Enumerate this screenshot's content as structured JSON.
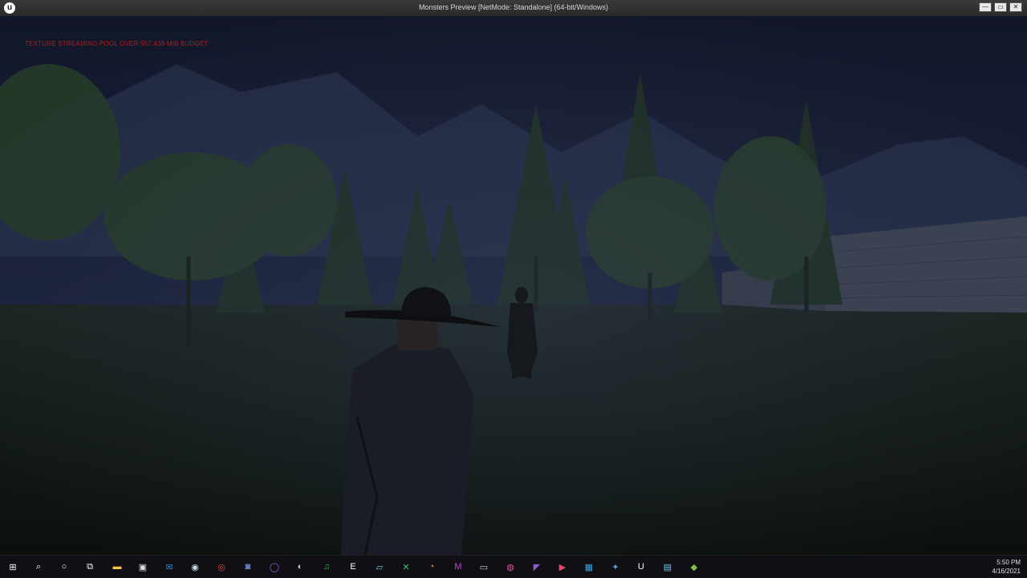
{
  "window": {
    "title": "Monsters Preview [NetMode: Standalone]  (64-bit/Windows)",
    "logo_letter": "u",
    "controls": [
      "—",
      "▭",
      "✕"
    ]
  },
  "viewport": {
    "warning": "TEXTURE STREAMING POOL OVER 557.438 MiB BUDGET",
    "warning_color": "#b01c1c"
  },
  "taskbar": {
    "icons": [
      {
        "name": "start-icon",
        "glyph": "⊞",
        "color": "#ffffff"
      },
      {
        "name": "search-icon",
        "glyph": "⌕",
        "color": "#ffffff"
      },
      {
        "name": "cortana-icon",
        "glyph": "○",
        "color": "#ffffff"
      },
      {
        "name": "task-view-icon",
        "glyph": "⧉",
        "color": "#ffffff"
      },
      {
        "name": "file-explorer-icon",
        "glyph": "▬",
        "color": "#f2c14e"
      },
      {
        "name": "store-icon",
        "glyph": "▣",
        "color": "#dddddd"
      },
      {
        "name": "mail-icon",
        "glyph": "✉",
        "color": "#2b88d8"
      },
      {
        "name": "steam-icon",
        "glyph": "◉",
        "color": "#cfd8e3"
      },
      {
        "name": "chrome-icon",
        "glyph": "◎",
        "color": "#e34133"
      },
      {
        "name": "discord-icon",
        "glyph": "◙",
        "color": "#7289da"
      },
      {
        "name": "app-circle-icon",
        "glyph": "◯",
        "color": "#9b59d0"
      },
      {
        "name": "obs-icon",
        "glyph": "◐",
        "color": "#cccccc"
      },
      {
        "name": "spotify-icon",
        "glyph": "♫",
        "color": "#1db954"
      },
      {
        "name": "epic-games-icon",
        "glyph": "E",
        "color": "#ffffff"
      },
      {
        "name": "notes-icon",
        "glyph": "▱",
        "color": "#7fd3e0"
      },
      {
        "name": "xbox-icon",
        "glyph": "✕",
        "color": "#33c36b"
      },
      {
        "name": "blender-icon",
        "glyph": "◔",
        "color": "#f0922b"
      },
      {
        "name": "app-m-icon",
        "glyph": "M",
        "color": "#b24bcf"
      },
      {
        "name": "terminal-icon",
        "glyph": "▭",
        "color": "#cccccc"
      },
      {
        "name": "photos-icon",
        "glyph": "◍",
        "color": "#e64aa0"
      },
      {
        "name": "visual-studio-icon",
        "glyph": "◤",
        "color": "#8e5bd6"
      },
      {
        "name": "media-icon",
        "glyph": "▶",
        "color": "#e64a6a"
      },
      {
        "name": "calendar-icon",
        "glyph": "▦",
        "color": "#3aa0e8"
      },
      {
        "name": "settings-app-icon",
        "glyph": "✦",
        "color": "#5aa0e0"
      },
      {
        "name": "unreal-engine-icon",
        "glyph": "U",
        "color": "#ffffff"
      },
      {
        "name": "image-viewer-icon",
        "glyph": "▤",
        "color": "#6ec1f0"
      },
      {
        "name": "shield-icon",
        "glyph": "◆",
        "color": "#7fbf4a"
      }
    ],
    "time": "5:50 PM",
    "date": "4/16/2021"
  },
  "colors": {
    "sky": "#1a2038",
    "ground": "#0e1610",
    "foliage": "#1f3322"
  }
}
